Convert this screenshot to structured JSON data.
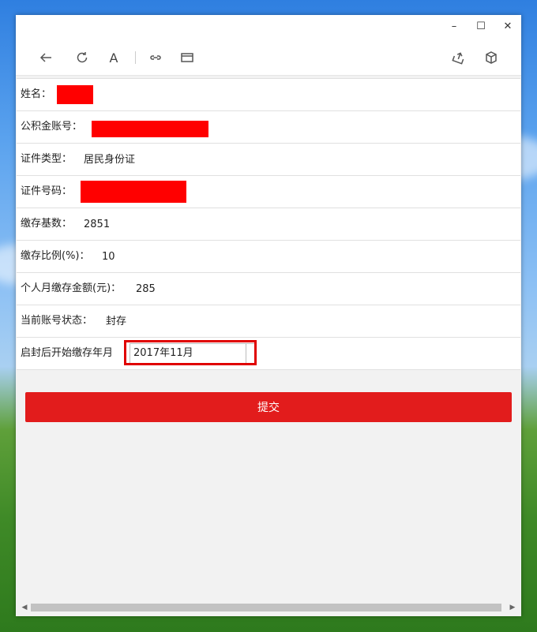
{
  "window": {
    "controls": {
      "minimize": "–",
      "maximize": "☐",
      "close": "✕"
    }
  },
  "toolbar": {
    "icons": [
      "back-icon",
      "refresh-icon",
      "font-size-icon",
      "link-icon",
      "reading-view-icon",
      "share-icon",
      "package-icon"
    ],
    "font_glyph": "A"
  },
  "form": {
    "name_label": "姓名：",
    "account_label": "公积金账号：",
    "id_type_label": "证件类型：",
    "id_type_value": "居民身份证",
    "id_number_label": "证件号码：",
    "base_label": "缴存基数：",
    "base_value": "2851",
    "ratio_label": "缴存比例(%)：",
    "ratio_value": "10",
    "monthly_label": "个人月缴存金额(元)：",
    "monthly_value": "285",
    "status_label": "当前账号状态：",
    "status_value": "封存",
    "start_label": "启封后开始缴存年月",
    "start_value": "2017年11月"
  },
  "submit_label": "提交",
  "colors": {
    "accent": "#e21c1c",
    "redaction": "#ff0000",
    "highlight": "#e00000"
  }
}
